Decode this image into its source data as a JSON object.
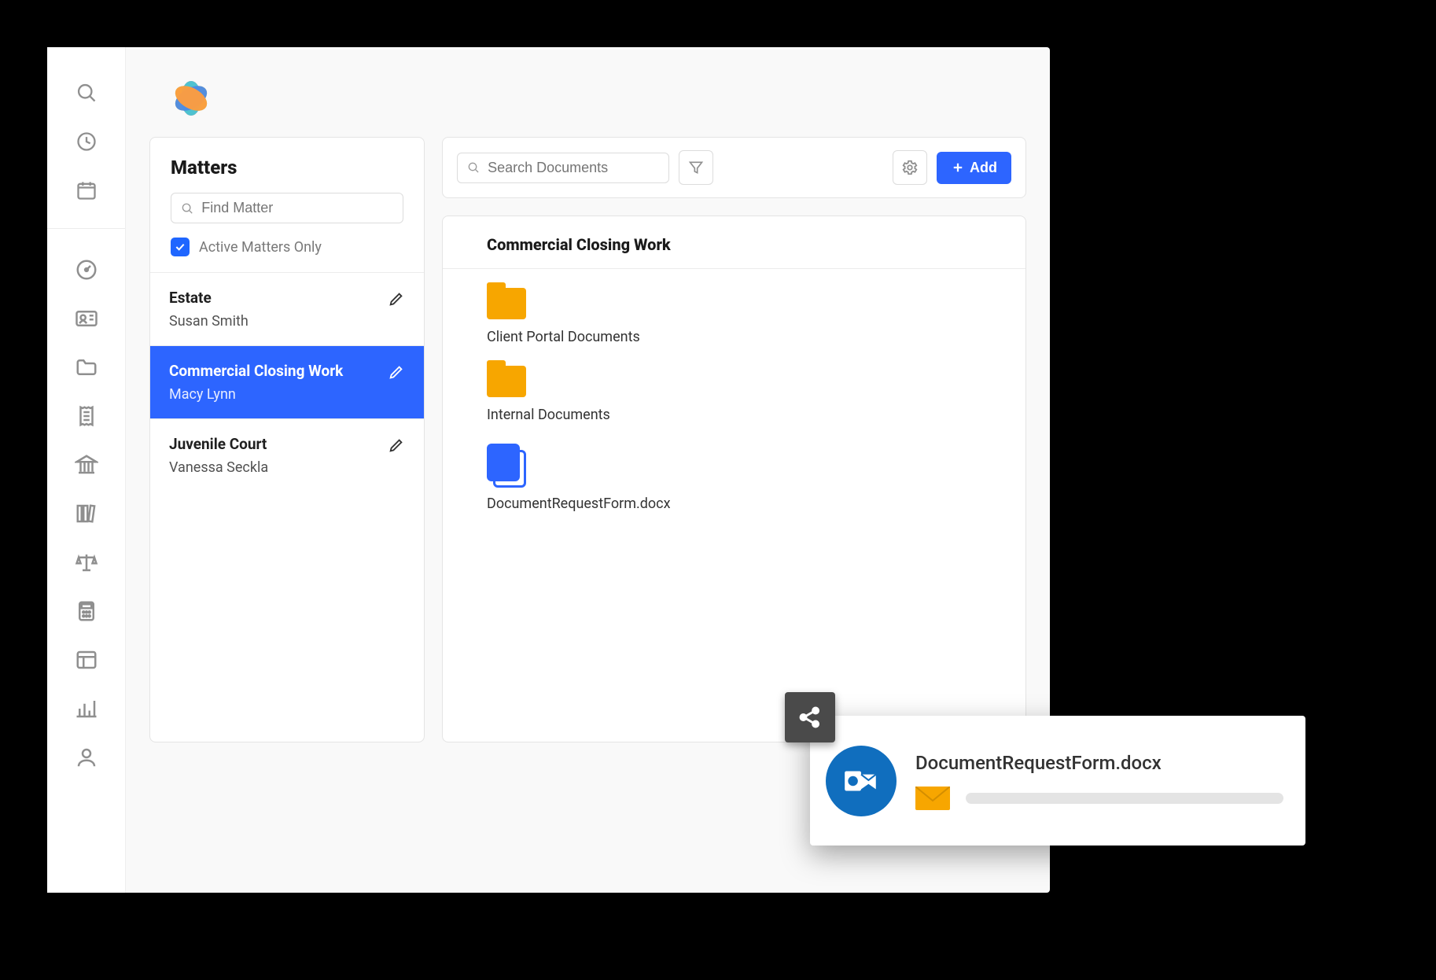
{
  "colors": {
    "accent": "#2d65ff",
    "folder": "#f7a600",
    "outlook": "#106ebe",
    "share_tile": "#4a4a4a"
  },
  "icon_rail": {
    "top_icons": [
      "search-icon",
      "clock-icon",
      "calendar-icon"
    ],
    "bottom_icons": [
      "gauge-icon",
      "contact-card-icon",
      "folder-icon",
      "receipt-icon",
      "bank-icon",
      "books-icon",
      "scales-icon",
      "calculator-icon",
      "layout-icon",
      "bar-chart-icon",
      "person-icon"
    ]
  },
  "matters_panel": {
    "title": "Matters",
    "find_placeholder": "Find Matter",
    "active_only_label": "Active Matters Only",
    "active_only_checked": true,
    "items": [
      {
        "name": "Estate",
        "client": "Susan Smith",
        "selected": false
      },
      {
        "name": "Commercial Closing Work",
        "client": "Macy Lynn",
        "selected": true
      },
      {
        "name": "Juvenile Court",
        "client": "Vanessa Seckla",
        "selected": false
      }
    ]
  },
  "toolbar": {
    "search_placeholder": "Search Documents",
    "filter_icon": "funnel-icon",
    "settings_icon": "gear-icon",
    "add_label": "Add"
  },
  "documents": {
    "title": "Commercial Closing Work",
    "items": [
      {
        "type": "folder",
        "label": "Client Portal Documents"
      },
      {
        "type": "folder",
        "label": "Internal Documents"
      },
      {
        "type": "docx",
        "label": "DocumentRequestForm.docx"
      }
    ]
  },
  "share_popup": {
    "tile_icon": "share-icon",
    "app_icon": "outlook-icon",
    "title": "DocumentRequestForm.docx",
    "row_icon": "mail-icon"
  }
}
